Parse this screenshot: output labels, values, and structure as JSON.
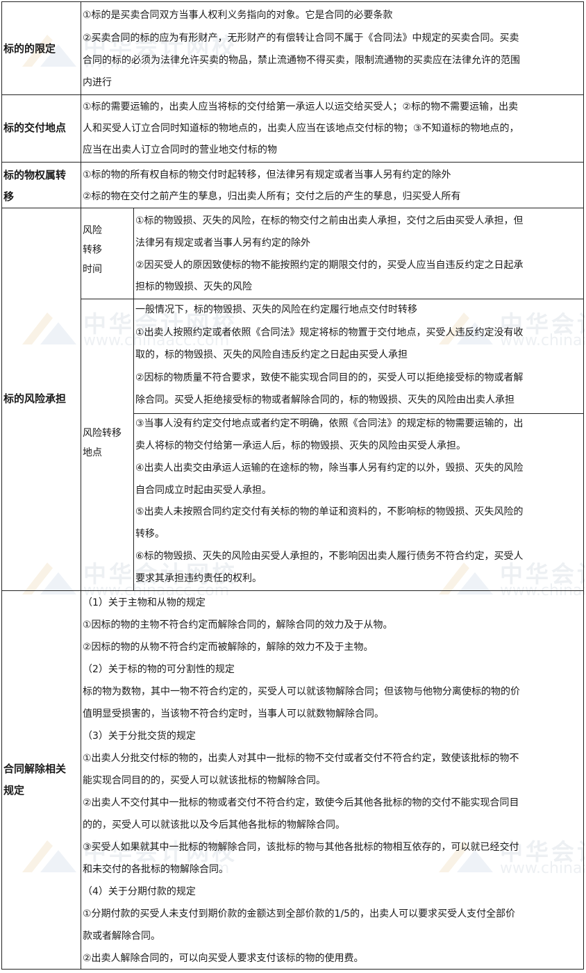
{
  "watermark": {
    "cn": "中华会计网校",
    "url": "www.chinaacc.com"
  },
  "rows": {
    "r1": {
      "header": "标的的限定",
      "lines": [
        "①标的是买卖合同双方当事人权利义务指向的对象。它是合同的必要条款",
        "②买卖合同的标的应为有形财产，无形财产的有偿转让合同不属于《合同法》中规定的买卖合同。买卖",
        "合同的标的必须为法律允许买卖的物品，禁止流通物不得买卖，限制流通物的买卖应在法律允许的范围",
        "内进行"
      ]
    },
    "r2": {
      "header": "标的交付地点",
      "lines": [
        "①标的需要运输的，出卖人应当将标的交付给第一承运人以运交给买受人；②标的物不需要运输，出卖",
        "人和买受人订立合同时知道标的物地点的，出卖人应当在该地点交付标的物；③不知道标的物地点的，",
        "应当在出卖人订立合同时的营业地交付标的物"
      ]
    },
    "r3": {
      "header": "标的物权属转\n移",
      "lines": [
        "①标的物的所有权自标的物交付时起转移，但法律另有规定或者当事人另有约定的除外",
        "②标的物在交付之前产生的孳息，归出卖人所有；交付之后的产生的孳息，归买受人所有"
      ]
    },
    "r4": {
      "header": "标的风险承担",
      "sub1": {
        "label": "风险\n转移\n时间",
        "lines": [
          "①标的物毁损、灭失的风险，在标的物交付之前由出卖人承担，交付之后由买受人承担，但",
          "法律另有规定或者当事人另有约定的除外",
          "②因买受人的原因致使标的物不能按照约定的期限交付的，买受人应当自违反约定之日起承",
          "担标的物毁损、灭失的风险"
        ]
      },
      "sub2": {
        "label": "风险转移\n地点",
        "block_a": [
          "一般情况下，标的物毁损、灭失的风险在约定履行地点交付时转移",
          "①出卖人按照约定或者依照《合同法》规定将标的物置于交付地点，买受人违反约定没有收",
          "取的，标的物毁损、灭失的风险自违反约定之日起由买受人承担",
          "②因标的物质量不符合要求，致使不能实现合同目的的，买受人可以拒绝接受标的物或者解",
          "除合同。买受人拒绝接受标的物或者解除合同的，标的物毁损、灭失的风险由出卖人承担"
        ],
        "block_b": [
          "③当事人没有约定交付地点或者约定不明确，依照《合同法》的规定标的物需要运输的，出",
          "卖人将标的物交付给第一承运人后，标的物毁损、灭失的风险由买受人承担。",
          "④出卖人出卖交由承运人运输的在途标的物，除当事人另有约定的以外，毁损、灭失的风险",
          "自合同成立时起由买受人承担。",
          "⑤出卖人未按照合同约定交付有关标的物的单证和资料的，不影响标的物毁损、灭失风险的",
          "转移。",
          "⑥标的物毁损、灭失的风险由买受人承担的，不影响因出卖人履行债务不符合约定，买受人",
          "要求其承担违约责任的权利。"
        ]
      }
    },
    "r5": {
      "header": "合同解除相关\n规定",
      "lines": [
        "（1）关于主物和从物的规定",
        "①因标的物的主物不符合约定而解除合同的，解除合同的效力及于从物。",
        "②因标的物的从物不符合约定而被解除的，解除的效力不及于主物。",
        "（2）关于标的物的可分割性的规定",
        "标的物为数物，其中一物不符合约定的，买受人可以就该物解除合同；但该物与他物分离使标的物的价",
        "值明显受损害的，当该物不符合约定时，当事人可以就数物解除合同。",
        "（3）关于分批交货的规定",
        "①出卖人分批交付标的物的，出卖人对其中一批标的物不交付或者交付不符合约定，致使该批标的物不",
        "能实现合同目的的，买受人可以就该批标的物解除合同。",
        "②出卖人不交付其中一批标的物或者交付不符合约定，致使今后其他各批标的物的交付不能实现合同目",
        "的的，买受人可以就该批以及今后其他各批标的物解除合同。",
        "③买受人如果就其中一批标的物解除合同，该批标的物与其他各批标的物相互依存的，可以就已经交付",
        "和未交付的各批标的物解除合同。",
        "（4）关于分期付款的规定",
        "①分期付款的买受人未支付到期价款的金额达到全部价款的1/5的，出卖人可以要求买受人支付全部价",
        "款或者解除合同。",
        "②出卖人解除合同的，可以向买受人要求支付该标的物的使用费。"
      ]
    }
  }
}
